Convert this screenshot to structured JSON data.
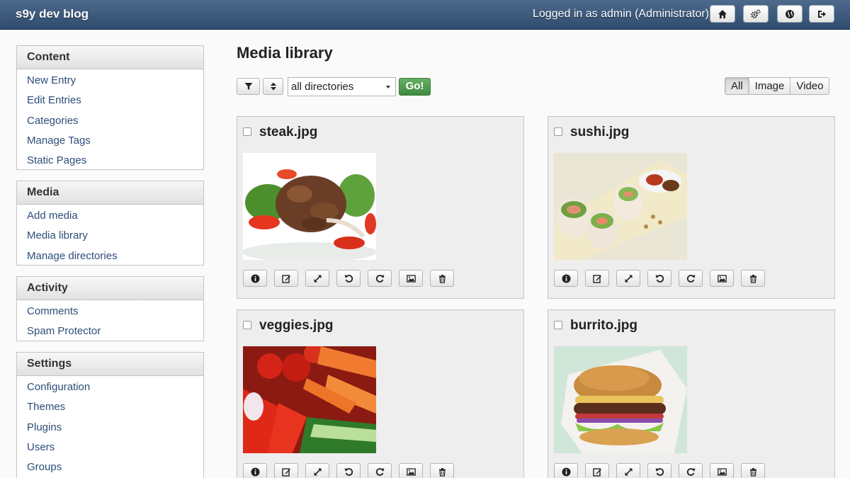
{
  "header": {
    "brand": "s9y dev blog",
    "login_status": "Logged in as admin (Administrator)",
    "buttons": [
      {
        "icon": "home-icon"
      },
      {
        "icon": "gears-icon"
      },
      {
        "icon": "globe-icon"
      },
      {
        "icon": "logout-icon"
      }
    ]
  },
  "sidebar": {
    "sections": [
      {
        "title": "Content",
        "items": [
          "New Entry",
          "Edit Entries",
          "Categories",
          "Manage Tags",
          "Static Pages"
        ]
      },
      {
        "title": "Media",
        "items": [
          "Add media",
          "Media library",
          "Manage directories"
        ]
      },
      {
        "title": "Activity",
        "items": [
          "Comments",
          "Spam Protector"
        ]
      },
      {
        "title": "Settings",
        "items": [
          "Configuration",
          "Themes",
          "Plugins",
          "Users",
          "Groups"
        ]
      }
    ]
  },
  "main": {
    "title": "Media library",
    "toolbar": {
      "directory_selected": "all directories",
      "go_label": "Go!",
      "filters": [
        "All",
        "Image",
        "Video"
      ],
      "active_filter": "All"
    },
    "media_items": [
      {
        "filename": "steak.jpg",
        "thumb": "steak-salad-photo"
      },
      {
        "filename": "sushi.jpg",
        "thumb": "sushi-rolls-photo"
      },
      {
        "filename": "veggies.jpg",
        "thumb": "vegetables-photo"
      },
      {
        "filename": "burrito.jpg",
        "thumb": "burger-photo"
      }
    ],
    "item_actions": [
      "info-icon",
      "edit-icon",
      "resize-icon",
      "rotate-left-icon",
      "rotate-right-icon",
      "image-icon",
      "trash-icon"
    ]
  },
  "colors": {
    "topbar": "#3d5a7e",
    "link": "#2c4e78",
    "go_button": "#4f9a4f"
  }
}
